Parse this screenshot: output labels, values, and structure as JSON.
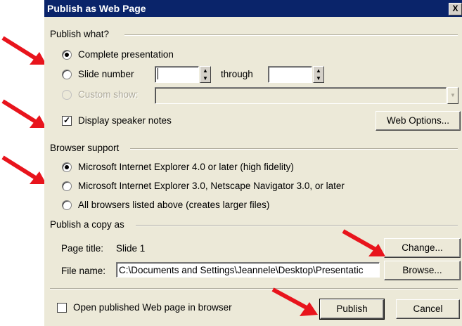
{
  "window": {
    "title": "Publish as Web Page",
    "close": "X"
  },
  "publish_what": {
    "heading": "Publish what?",
    "complete": "Complete presentation",
    "slide_number": "Slide number",
    "through": "through",
    "custom_show": "Custom show:",
    "speaker_notes": "Display speaker notes",
    "web_options": "Web Options..."
  },
  "browser_support": {
    "heading": "Browser support",
    "ie4": "Microsoft Internet Explorer 4.0 or later (high fidelity)",
    "ie3": "Microsoft Internet Explorer 3.0, Netscape Navigator 3.0, or later",
    "all": "All browsers listed above (creates larger files)"
  },
  "publish_copy": {
    "heading": "Publish a copy as",
    "page_title_label": "Page title:",
    "page_title_value": "Slide 1",
    "change": "Change...",
    "file_name_label": "File name:",
    "file_name_value": "C:\\Documents and Settings\\Jeannele\\Desktop\\Presentatic",
    "browse": "Browse..."
  },
  "footer": {
    "open_in_browser": "Open published Web page in browser",
    "publish": "Publish",
    "cancel": "Cancel"
  },
  "colors": {
    "title_bar": "#0a246a",
    "dialog_bg": "#ece9d8",
    "annotation_arrow": "#e8141c"
  }
}
